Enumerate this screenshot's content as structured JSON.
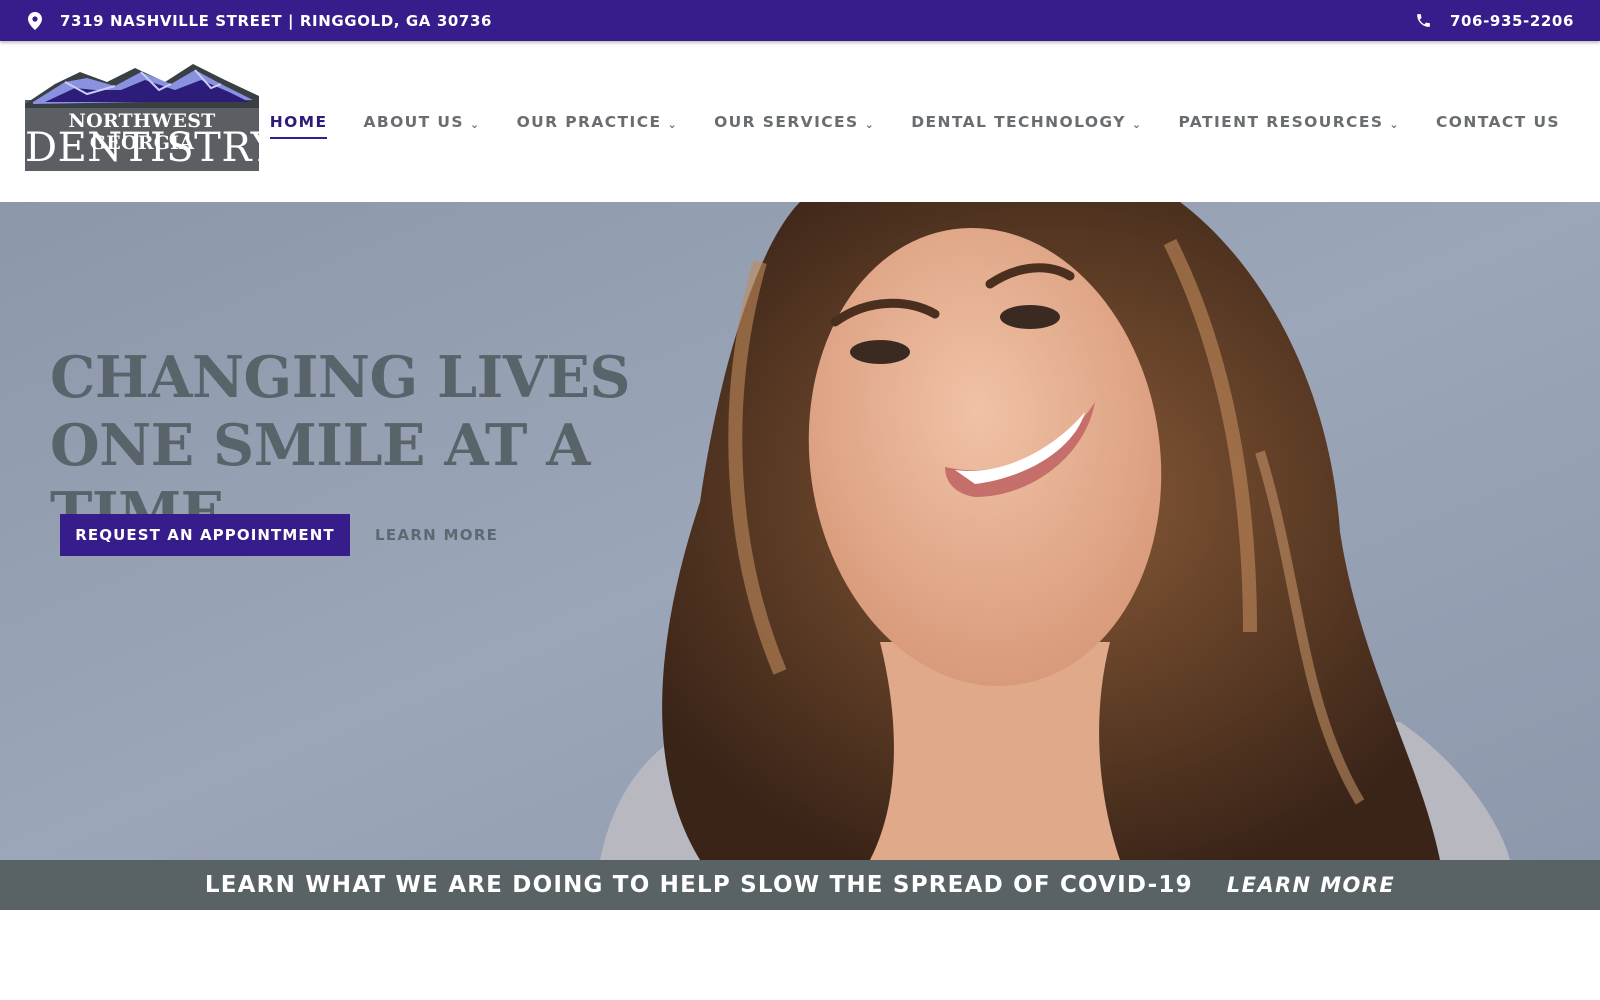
{
  "topbar": {
    "address": "7319 NASHVILLE STREET | RINGGOLD, GA 30736",
    "phone": "706-935-2206",
    "address_icon": "map-pin-icon",
    "phone_icon": "phone-icon",
    "background": "#361d8b"
  },
  "logo": {
    "line1": "NORTHWEST GEORGIA",
    "line2": "DENTISTRY"
  },
  "nav": {
    "items": [
      {
        "label": "HOME",
        "active": true,
        "dropdown": false
      },
      {
        "label": "ABOUT US",
        "dropdown": true
      },
      {
        "label": "OUR PRACTICE",
        "dropdown": true
      },
      {
        "label": "OUR SERVICES",
        "dropdown": true
      },
      {
        "label": "DENTAL TECHNOLOGY",
        "dropdown": true
      },
      {
        "label": "PATIENT RESOURCES",
        "dropdown": true
      },
      {
        "label": "CONTACT US",
        "dropdown": false
      }
    ],
    "chevron": "⌄"
  },
  "hero": {
    "headline": "CHANGING LIVES ONE SMILE AT A TIME",
    "primary_button": "REQUEST AN APPOINTMENT",
    "secondary_link": "LEARN MORE"
  },
  "covid_banner": {
    "message": "LEARN WHAT WE ARE DOING TO HELP SLOW THE SPREAD OF COVID-19",
    "link": "LEARN MORE",
    "background": "#596265"
  },
  "colors": {
    "brand_purple": "#361d8b",
    "nav_gray": "#6a6d70",
    "headline_gray": "#58636a"
  }
}
